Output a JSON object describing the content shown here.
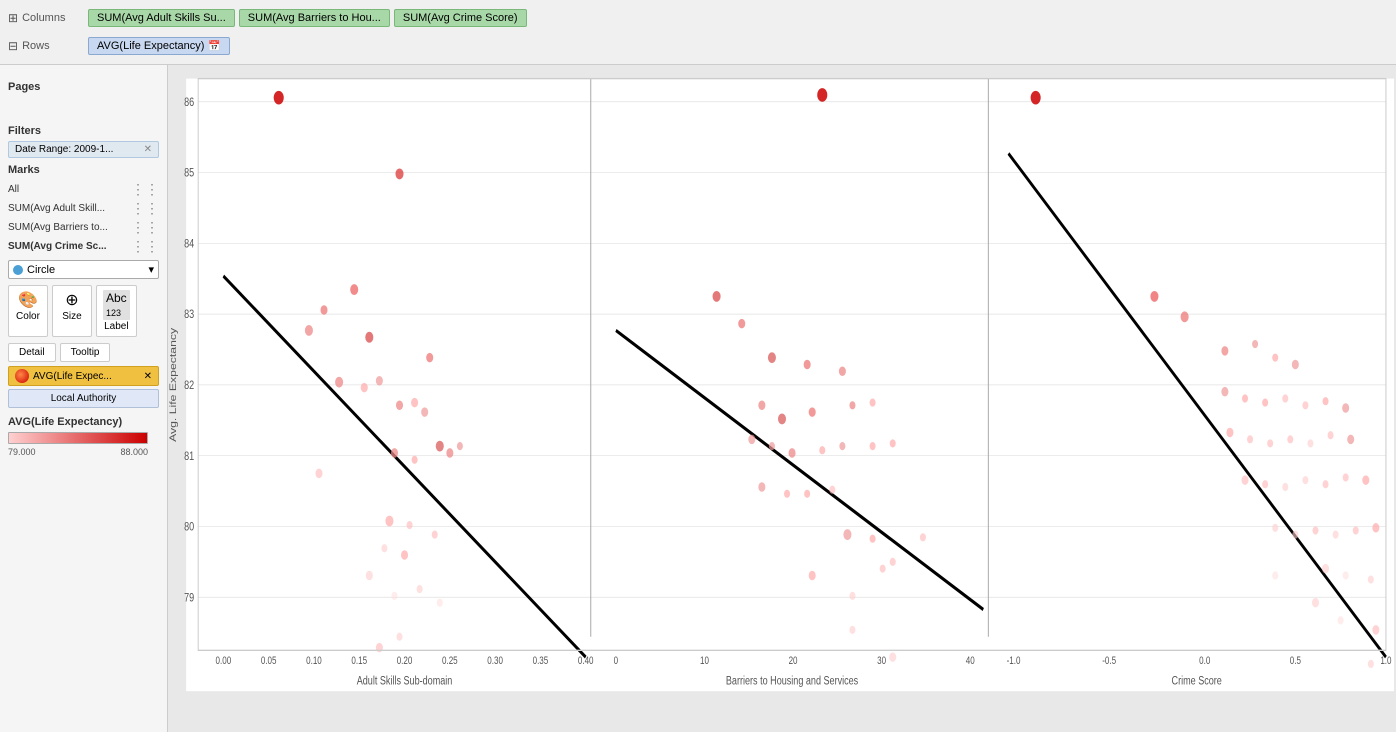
{
  "pages": {
    "label": "Pages"
  },
  "toolbar": {
    "columns_label": "Columns",
    "rows_label": "Rows",
    "columns_pills": [
      {
        "label": "SUM(Avg Adult Skills Su...",
        "type": "green"
      },
      {
        "label": "SUM(Avg Barriers to Hou...",
        "type": "green"
      },
      {
        "label": "SUM(Avg Crime Score)",
        "type": "green"
      }
    ],
    "rows_pill": {
      "label": "AVG(Life Expectancy)"
    }
  },
  "sidebar": {
    "filters_title": "Filters",
    "filter_item": "Date Range: 2009-1...",
    "marks_title": "Marks",
    "marks_all": "All",
    "marks_rows": [
      {
        "label": "SUM(Avg Adult Skill..."
      },
      {
        "label": "SUM(Avg Barriers to..."
      },
      {
        "label": "SUM(Avg Crime Sc..."
      }
    ],
    "dropdown_value": "Circle",
    "btn_color": "Color",
    "btn_size": "Size",
    "btn_label": "Label",
    "btn_detail": "Detail",
    "btn_tooltip": "Tooltip",
    "avg_pill": "AVG(Life Expec...",
    "local_authority": "Local Authority"
  },
  "legend": {
    "title": "AVG(Life Expectancy)",
    "min": "79.000",
    "max": "88.000"
  },
  "chart": {
    "y_axis_label": "Avg. Life Expectancy",
    "y_ticks": [
      "86",
      "85",
      "84",
      "83",
      "82",
      "81",
      "80",
      "79"
    ],
    "panels": [
      {
        "x_axis_label": "Adult Skills Sub-domain",
        "x_ticks": [
          "0.00",
          "0.05",
          "0.10",
          "0.15",
          "0.20",
          "0.25",
          "0.30",
          "0.35",
          "0.40"
        ]
      },
      {
        "x_axis_label": "Barriers to Housing and Services",
        "x_ticks": [
          "0",
          "10",
          "20",
          "30",
          "40"
        ]
      },
      {
        "x_axis_label": "Crime Score",
        "x_ticks": [
          "-1.0",
          "-0.5",
          "0.0",
          "0.5",
          "1.0"
        ]
      }
    ]
  }
}
